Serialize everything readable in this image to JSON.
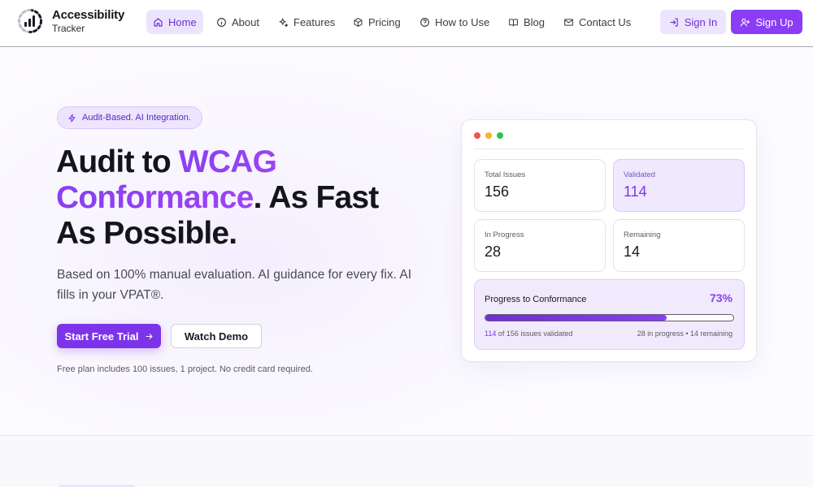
{
  "brand": {
    "title": "Accessibility",
    "subtitle": "Tracker"
  },
  "nav": {
    "items": [
      {
        "label": "Home",
        "icon": "home-icon",
        "active": true
      },
      {
        "label": "About",
        "icon": "info-icon"
      },
      {
        "label": "Features",
        "icon": "sparkles-icon"
      },
      {
        "label": "Pricing",
        "icon": "box-icon"
      },
      {
        "label": "How to Use",
        "icon": "help-circle-icon"
      },
      {
        "label": "Blog",
        "icon": "book-icon"
      },
      {
        "label": "Contact Us",
        "icon": "mail-icon"
      }
    ],
    "sign_in": "Sign In",
    "sign_up": "Sign Up"
  },
  "hero": {
    "badge": "Audit-Based. AI Integration.",
    "headline_1": "Audit to ",
    "headline_accent_1": "WCAG",
    "headline_accent_2": "Conformance",
    "headline_2": ". As Fast As Possible.",
    "subtext": "Based on 100% manual evaluation. AI guidance for every fix. AI fills in your VPAT®.",
    "cta_primary": "Start Free Trial",
    "cta_secondary": "Watch Demo",
    "fineprint": "Free plan includes 100 issues, 1 project. No credit card required."
  },
  "dashboard": {
    "window_dots": [
      "#f0564f",
      "#f6b42a",
      "#2cc34c"
    ],
    "stats": [
      {
        "label": "Total Issues",
        "value": "156",
        "highlight": false
      },
      {
        "label": "Validated",
        "value": "114",
        "highlight": true
      },
      {
        "label": "In Progress",
        "value": "28",
        "highlight": false
      },
      {
        "label": "Remaining",
        "value": "14",
        "highlight": false
      }
    ],
    "progress": {
      "title": "Progress to Conformance",
      "percent_label": "73%",
      "percent": 73,
      "validated": "114",
      "validated_suffix": " of 156 issues validated",
      "right_note": "28 in progress • 14 remaining"
    }
  },
  "colors": {
    "accent": "#8b3cf5",
    "accent_dark": "#7c33ea",
    "accent_soft": "#ece5fd"
  }
}
